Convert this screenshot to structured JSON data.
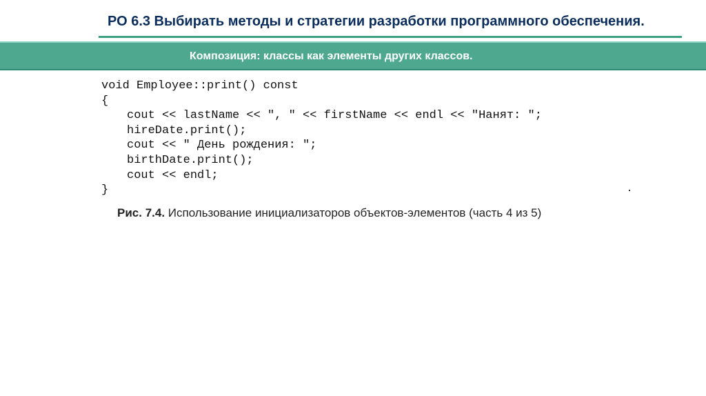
{
  "slide": {
    "title": "РО 6.3 Выбирать методы и стратегии разработки программного обеспечения.",
    "banner": "Композиция: классы как элементы других классов."
  },
  "code": {
    "lines": [
      "void Employee::print() const",
      "{",
      "cout << lastName << \", \" << firstName << endl << \"Нанят: \";",
      "hireDate.print();",
      "cout << \" День рождения: \";",
      "birthDate.print();",
      "cout << endl;",
      "}"
    ]
  },
  "caption": {
    "label": "Рис. 7.4.",
    "text": " Использование инициализаторов объектов-элементов (часть 4 из 5)"
  },
  "colors": {
    "title_text": "#0b2d5b",
    "accent_green": "#4ea88f",
    "underline_green": "#3a9f83"
  }
}
